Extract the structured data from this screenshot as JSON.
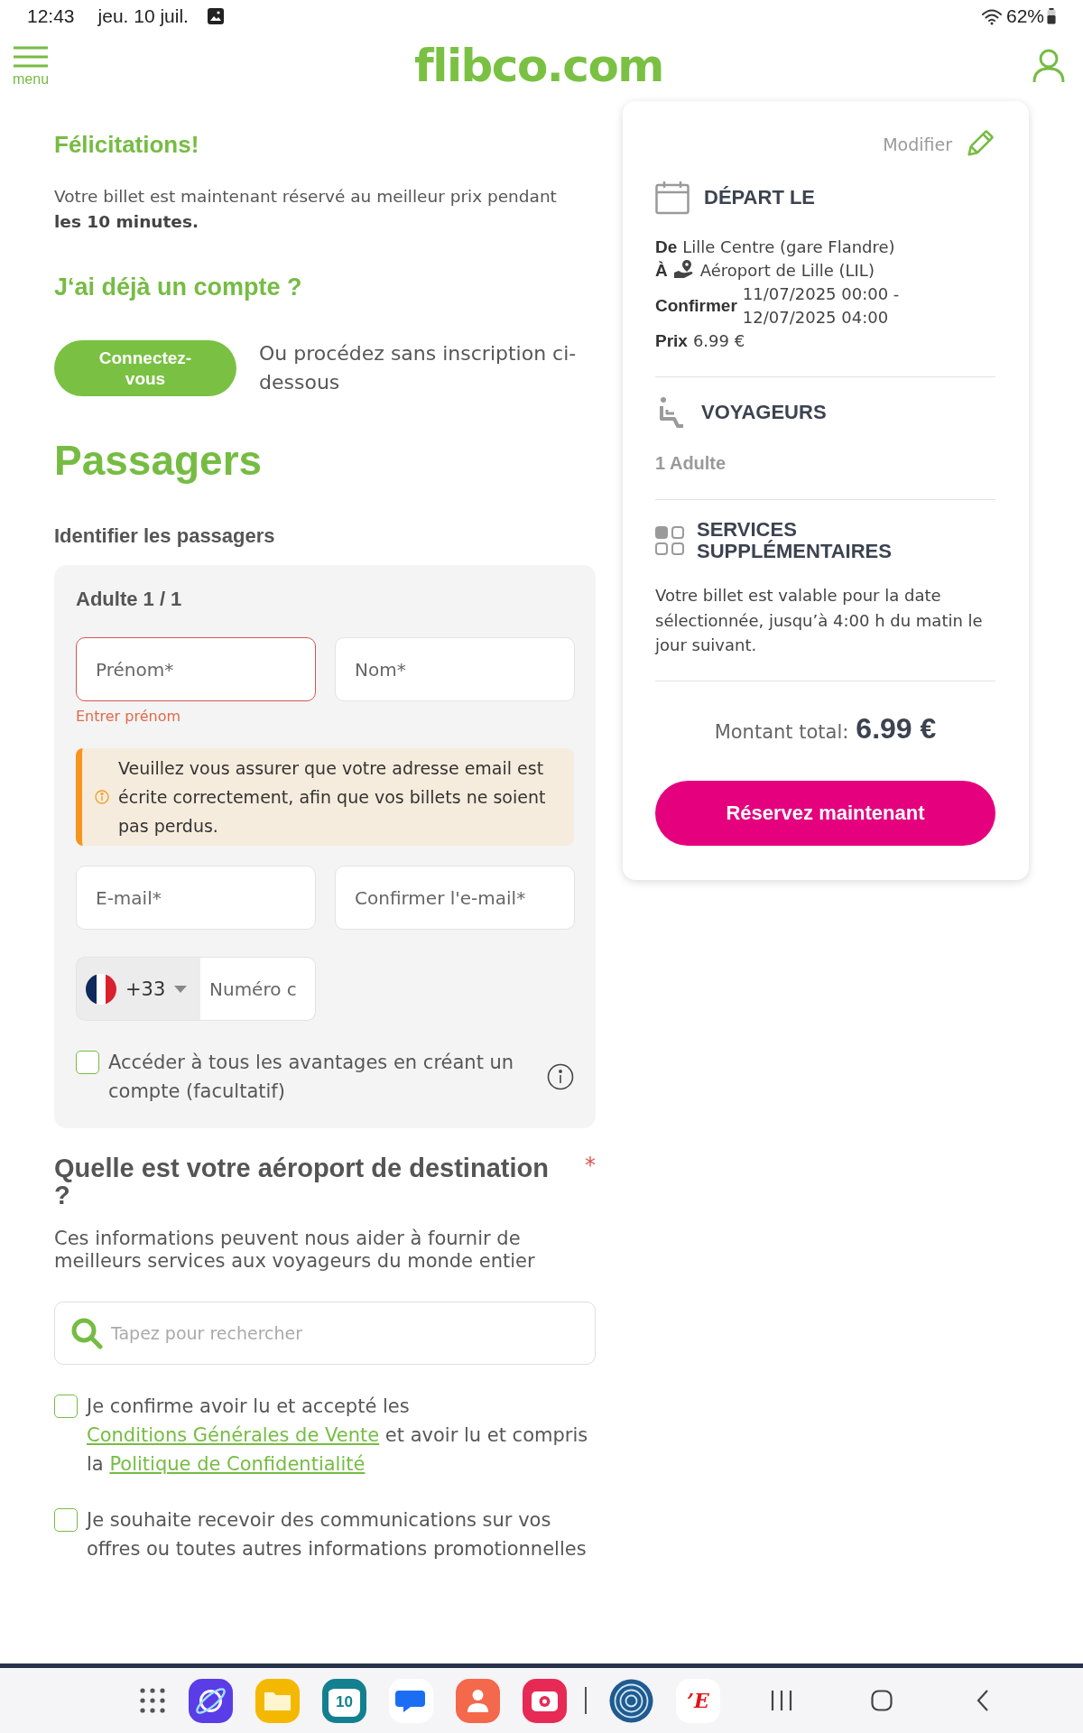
{
  "status_bar": {
    "time": "12:43",
    "date": "jeu. 10 juil.",
    "battery": "62%"
  },
  "header": {
    "menu_label": "menu",
    "logo": "flibco.com"
  },
  "intro": {
    "title": "Félicitations!",
    "message": "Votre billet est maintenant réservé au meilleur prix pendant **les 10 minutes.**"
  },
  "account": {
    "title": "J‘ai déjà un compte ?",
    "login_button": "Connectez-vous",
    "alternative": "Ou procédez sans inscription ci-dessous"
  },
  "passengers": {
    "title": "Passagers",
    "subtitle": "Identifier les passagers",
    "card": {
      "title": "Adulte 1 / 1",
      "name_fields": [
        {
          "placeholder": "Prénom*",
          "invalid": true,
          "error": "Entrer prénom"
        },
        {
          "placeholder": "Nom*",
          "invalid": false
        }
      ],
      "notice": "Veuillez vous assurer que votre adresse email est écrite correctement, afin que vos billets ne soient pas perdus.",
      "email_fields": [
        {
          "placeholder": "E-mail*"
        },
        {
          "placeholder": "Confirmer l'e-mail*"
        }
      ],
      "phone": {
        "dial_code": "+33",
        "placeholder": "Numéro c"
      },
      "create_account": {
        "label": "Accéder à tous les avantages en créant un compte (facultatif)",
        "checked": false
      }
    }
  },
  "destination": {
    "question": "Quelle est votre aéroport de destination ?",
    "required_mark": "*",
    "hint": "Ces informations peuvent nous aider à fournir de meilleurs services aux voyageurs du monde entier",
    "search": {
      "placeholder": "Tapez pour rechercher"
    }
  },
  "consents": [
    {
      "checked": false,
      "parts": [
        {
          "kind": "text",
          "text": "Je confirme avoir lu et accepté les "
        },
        {
          "kind": "link",
          "text": "Conditions Générales de Vente"
        },
        {
          "kind": "text",
          "text": " et avoir lu et compris la "
        },
        {
          "kind": "link",
          "text": "Politique de Confidentialité"
        }
      ]
    },
    {
      "checked": false,
      "parts": [
        {
          "kind": "text",
          "text": "Je souhaite recevoir des communications sur vos offres ou toutes autres informations promotionnelles"
        }
      ]
    }
  ],
  "summary": {
    "edit_label": "Modifier",
    "departure": {
      "title": "DÉPART LE",
      "rows": [
        {
          "kind": "plain",
          "label": "De",
          "value": "Lille Centre (gare Flandre)"
        },
        {
          "kind": "destination",
          "label": "À",
          "value": "Aéroport de Lille (LIL)"
        },
        {
          "kind": "range",
          "label": "Confirmer",
          "value": "11/07/2025 00:00 - 12/07/2025 04:00"
        },
        {
          "kind": "plain",
          "label": "Prix",
          "value": "6.99 €"
        }
      ]
    },
    "travellers": {
      "title": "VOYAGEURS",
      "value": "1 Adulte"
    },
    "services": {
      "title": "SERVICES SUPPLÉMENTAIRES",
      "text": "Votre billet est valable pour la date sélectionnée, jusqu’à 4:00 h du matin le jour suivant."
    },
    "total": {
      "label": "Montant total:",
      "amount": "6.99 €"
    },
    "book_button": "Réservez maintenant"
  },
  "dock": {
    "apps": [
      {
        "kind": "browser"
      },
      {
        "kind": "files"
      },
      {
        "kind": "calendar",
        "label": "10"
      },
      {
        "kind": "messages"
      },
      {
        "kind": "contacts"
      },
      {
        "kind": "camera"
      },
      {
        "kind": "divider"
      },
      {
        "kind": "radar"
      },
      {
        "kind": "news",
        "label": "’E"
      }
    ]
  }
}
